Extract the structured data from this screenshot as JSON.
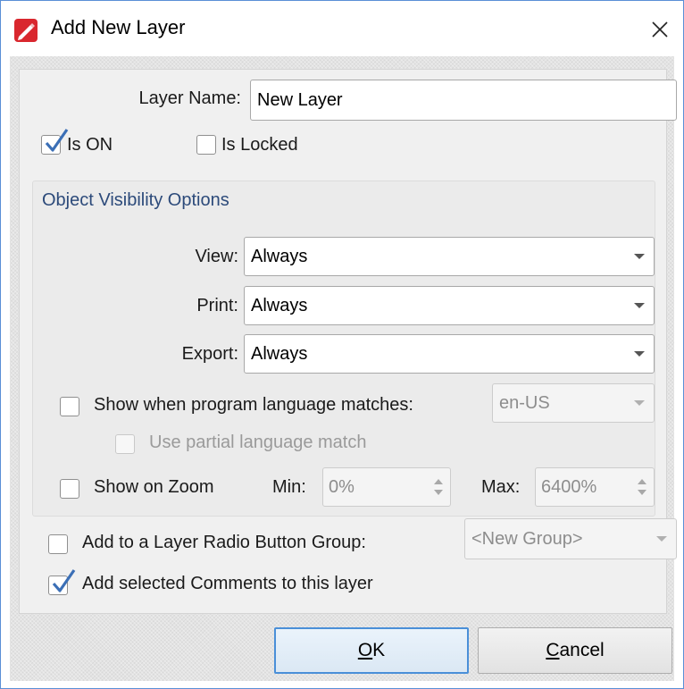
{
  "window": {
    "title": "Add New Layer",
    "app_icon": "pdf-editor-icon",
    "close_icon": "close-icon"
  },
  "layer_name": {
    "label": "Layer Name:",
    "value": "New Layer"
  },
  "is_on": {
    "label": "Is ON",
    "checked": true
  },
  "is_locked": {
    "label": "Is Locked",
    "checked": false
  },
  "visibility": {
    "title": "Object Visibility Options",
    "view": {
      "label": "View:",
      "value": "Always"
    },
    "print": {
      "label": "Print:",
      "value": "Always"
    },
    "export": {
      "label": "Export:",
      "value": "Always"
    },
    "language": {
      "label": "Show when program language matches:",
      "checked": false,
      "value": "en-US"
    },
    "partial": {
      "label": "Use partial language match",
      "checked": false,
      "enabled": false
    },
    "zoom": {
      "label": "Show on Zoom",
      "checked": false,
      "min_label": "Min:",
      "min_value": "0%",
      "max_label": "Max:",
      "max_value": "6400%"
    }
  },
  "radio_group": {
    "label": "Add to a Layer Radio Button Group:",
    "checked": false,
    "value": "<New Group>"
  },
  "add_comments": {
    "label": "Add selected Comments to this layer",
    "checked": true
  },
  "buttons": {
    "ok": {
      "mnemonic": "O",
      "rest": "K"
    },
    "cancel": {
      "mnemonic": "C",
      "rest": "ancel"
    }
  },
  "colors": {
    "accent": "#4a8fd8",
    "group_title": "#2c4a7a",
    "check": "#3b6fb6"
  }
}
